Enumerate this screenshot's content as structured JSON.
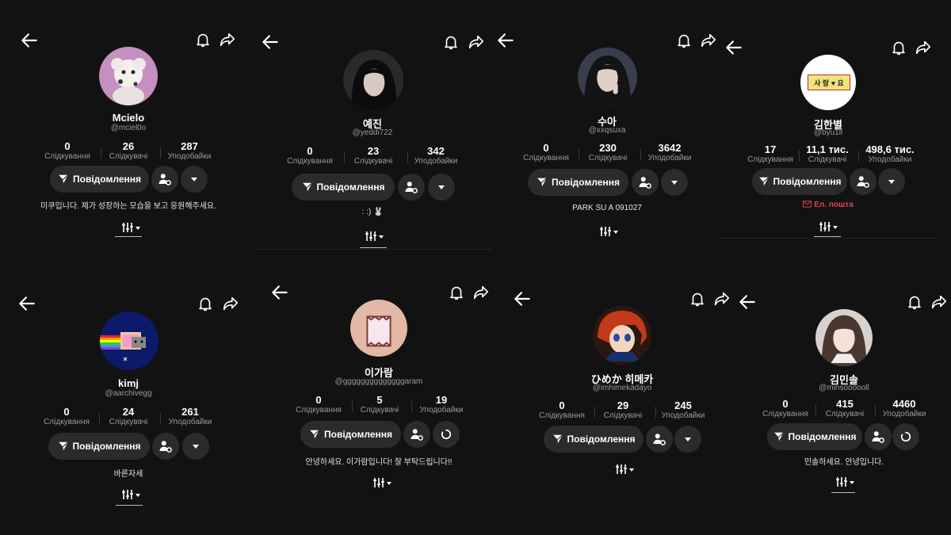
{
  "icons": {
    "back": "arrow-left-icon",
    "bell": "bell-icon",
    "share": "share-arrow-icon",
    "message": "paper-plane-icon",
    "follow_settings": "person-gear-icon",
    "dropdown": "chevron-down-icon",
    "loading": "loading-spinner-icon",
    "tabs": "grid-bars-icon",
    "email": "envelope-icon"
  },
  "labels": {
    "message_button": "Повідомлення",
    "following": "Слідкування",
    "followers": "Слідкувачі",
    "likes": "Уподобайки"
  },
  "profiles": [
    {
      "name": "Mcielo",
      "handle": "@mciel0o",
      "following": "0",
      "followers": "26",
      "likes": "287",
      "bio": "미쿠입니다. 제가 성장하는 모습을 보고 응원해주세요."
    },
    {
      "name": "예진",
      "handle": "@yeddi722",
      "following": "0",
      "followers": "23",
      "likes": "342",
      "bio": ": :) 🐰"
    },
    {
      "name": "수아",
      "handle": "@xxqsuxa",
      "following": "0",
      "followers": "230",
      "likes": "3642",
      "bio": "PARK SU A 091027"
    },
    {
      "name": "김한별",
      "handle": "@byu1ll",
      "following": "17",
      "followers": "11,1 тис.",
      "likes": "498,6 тис.",
      "email": "Ел. пошта",
      "avatar_text": "사 랑 ♥ 요"
    },
    {
      "name": "kimj",
      "handle": "@aarchivegg",
      "following": "0",
      "followers": "24",
      "likes": "261",
      "bio": "바른자세"
    },
    {
      "name": "이가람",
      "handle": "@ggggggggggggggaram",
      "following": "0",
      "followers": "5",
      "likes": "19",
      "bio": "안녕하세요. 이가람입니다! 잘 부탁드립니다!!"
    },
    {
      "name": "ひめか 히메카",
      "handle": "@imhimekadayo",
      "following": "0",
      "followers": "29",
      "likes": "245",
      "bio": ""
    },
    {
      "name": "김민솔",
      "handle": "@minsoooooll",
      "following": "0",
      "followers": "415",
      "likes": "4460",
      "bio": "민솔하세요. 안녕입니다."
    }
  ]
}
